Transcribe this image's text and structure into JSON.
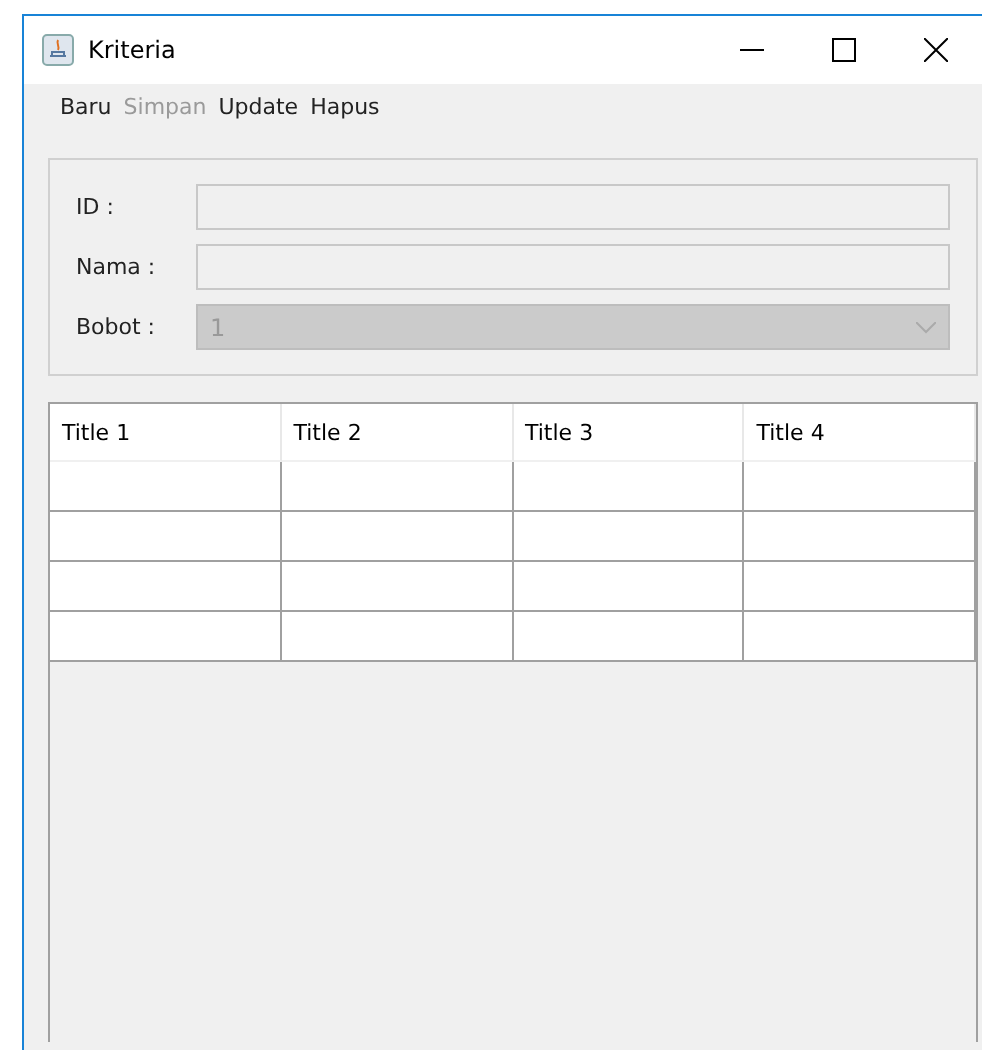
{
  "window": {
    "title": "Kriteria"
  },
  "menu": [
    {
      "label": "Baru",
      "disabled": false
    },
    {
      "label": "Simpan",
      "disabled": true
    },
    {
      "label": "Update",
      "disabled": false
    },
    {
      "label": "Hapus",
      "disabled": false
    }
  ],
  "form": {
    "fields": [
      {
        "kind": "text",
        "label": "ID :",
        "disabled": false
      },
      {
        "kind": "text",
        "label": "Nama :",
        "disabled": false
      },
      {
        "kind": "combo",
        "label": "Bobot :",
        "value": "1",
        "disabled": true
      }
    ]
  },
  "table": {
    "columns": [
      "Title 1",
      "Title 2",
      "Title 3",
      "Title 4"
    ]
  }
}
